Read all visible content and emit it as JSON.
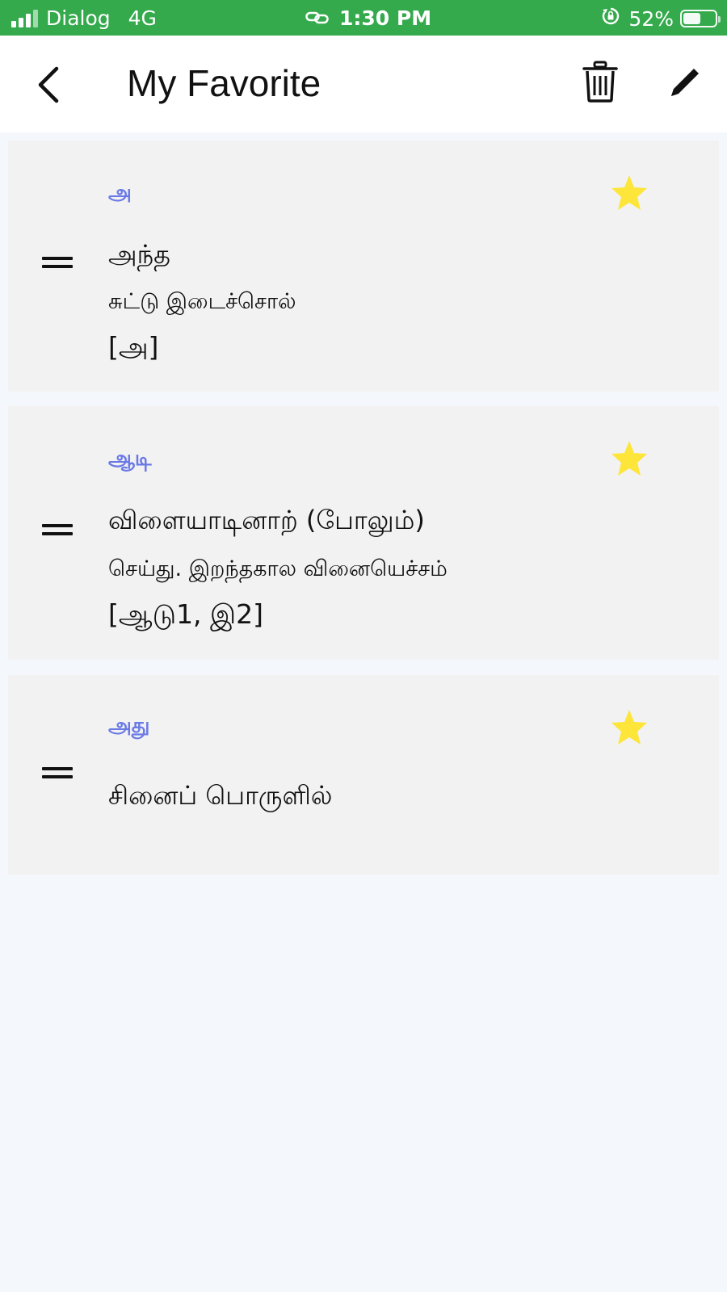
{
  "status_bar": {
    "carrier": "Dialog",
    "network": "4G",
    "time": "1:30 PM",
    "battery": "52%",
    "battery_level": 0.52,
    "icons": [
      "signal-icon",
      "link-icon",
      "rotation-lock-icon",
      "battery-icon"
    ]
  },
  "header": {
    "title": "My Favorite",
    "icons": [
      "back-icon",
      "trash-icon",
      "edit-icon"
    ]
  },
  "colors": {
    "status_bar": "#34aa4c",
    "headword": "#6a79e6",
    "star": "#fde53a",
    "card_bg": "#f2f2f2",
    "page_bg": "#f4f7fc"
  },
  "favorites": [
    {
      "headword": "அ",
      "meaning": "அந்த",
      "description": "சுட்டு இடைச்சொல்",
      "reference": "[அ]",
      "starred": true
    },
    {
      "headword": "ஆடி",
      "meaning": "விளையாடினாற் (போலும்)",
      "description": "செய்து. இறந்தகால வினையெச்சம்",
      "reference": "[ஆடு1, இ2]",
      "starred": true
    },
    {
      "headword": "அது",
      "meaning": "சினைப் பொருளில்",
      "starred": true
    }
  ]
}
